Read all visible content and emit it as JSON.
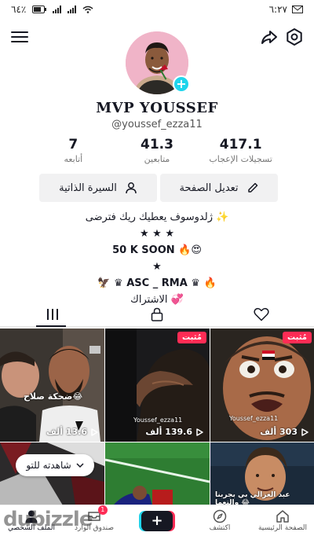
{
  "status_bar": {
    "time": "٦:٢٧",
    "battery": "٦٤٪"
  },
  "profile": {
    "display_name": "MVP YOUSSEF",
    "handle": "@youssef_ezza11"
  },
  "stats": [
    {
      "value": "7",
      "label": "أتابعه"
    },
    {
      "value": "41.3",
      "label": "متابعين"
    },
    {
      "value": "417.1",
      "label": "تسجيلات الإعجاب"
    }
  ],
  "actions": {
    "edit_profile": "تعديل الصفحة",
    "bio_button": "السيرة الذاتية"
  },
  "bio": {
    "line1": "ژلدوسوف يعطيك ريك فترضى ✨",
    "line2": "★ ★ ★",
    "line3": "50 K SOON 🔥😍",
    "line4": "★",
    "line5": "🦅 ♛ ASC _ RMA ♛ 🔥",
    "line6": "الاشتراك 💞"
  },
  "tabs": {
    "videos": "videos-grid",
    "private": "lock",
    "liked": "heart"
  },
  "videos": [
    {
      "views": "13.6 ألف",
      "caption": "ضحكة صلاح😂",
      "pinned": false
    },
    {
      "views": "139.6 ألف",
      "caption": "Youssef_ezza11",
      "pinned": true,
      "pin_label": "مُثبت"
    },
    {
      "views": "303 ألف",
      "caption": "Youssef_ezza11",
      "pinned": true,
      "pin_label": "مُثبت"
    },
    {
      "views": "",
      "caption": "",
      "pinned": false
    },
    {
      "views": "",
      "caption": "",
      "pinned": false
    },
    {
      "views": "",
      "caption": "عبد العزالي بي بجربنا والتعما 😂",
      "pinned": false
    }
  ],
  "watch_again": "شاهدته للتو",
  "bottom_nav": {
    "profile": "الملف الشخصي",
    "inbox": "صندوق الوارد",
    "inbox_badge": "1",
    "create": "+",
    "discover": "اكتشف",
    "home": "الصفحة الرئيسية"
  },
  "watermark": "dubizzle",
  "colors": {
    "accent_red": "#fe2c55",
    "accent_cyan": "#20d5ec",
    "text": "#161823"
  }
}
